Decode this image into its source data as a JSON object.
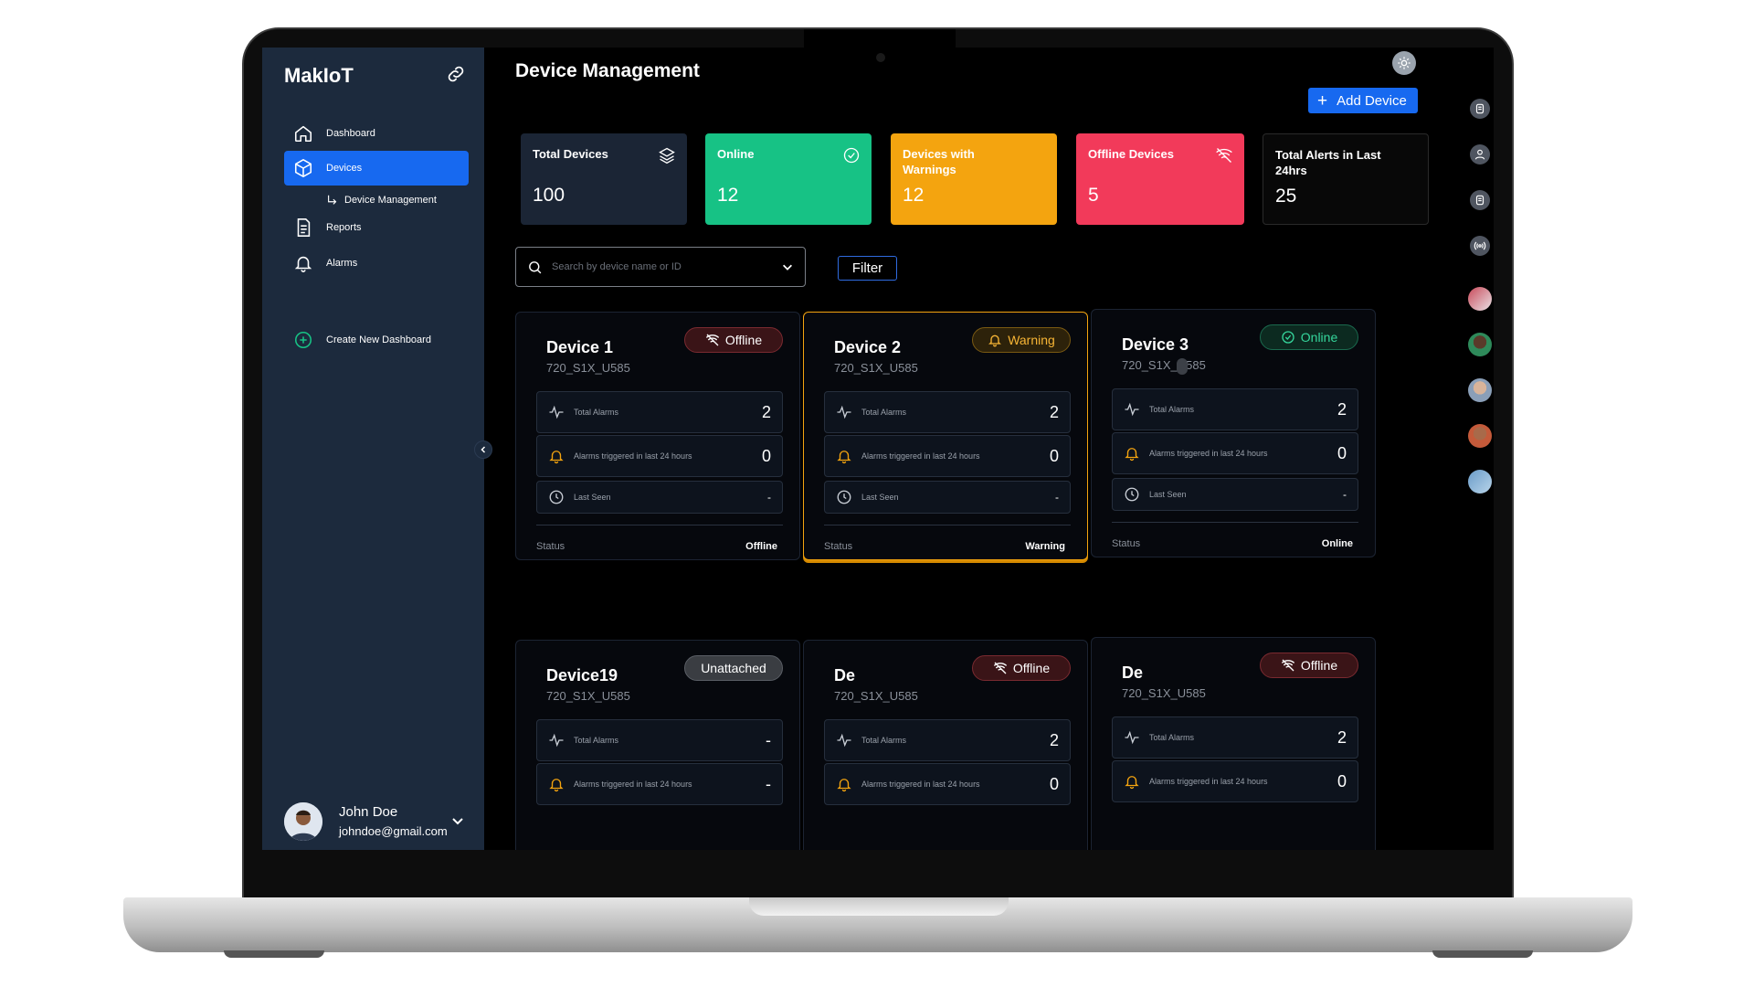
{
  "app": {
    "brand": "MakIoT"
  },
  "sidebar": {
    "items": [
      {
        "label": "Dashboard",
        "icon": "home-icon"
      },
      {
        "label": "Devices",
        "icon": "cube-icon"
      },
      {
        "label": "Reports",
        "icon": "document-icon"
      },
      {
        "label": "Alarms",
        "icon": "bell-icon"
      }
    ],
    "sub_item": "Device Management",
    "create_dashboard": "Create New Dashboard",
    "user": {
      "name": "John Doe",
      "email": "johndoe@gmail.com"
    }
  },
  "header": {
    "title": "Device Management",
    "add_device_label": "Add Device"
  },
  "stats": {
    "total": {
      "label": "Total Devices",
      "value": "100"
    },
    "online": {
      "label": "Online",
      "value": "12"
    },
    "warnings": {
      "label": "Devices with Warnings",
      "value": "12"
    },
    "offline": {
      "label": "Offline Devices",
      "value": "5"
    },
    "alerts": {
      "label": "Total Alerts in Last 24hrs",
      "value": "25"
    }
  },
  "search": {
    "placeholder": "Search by device name or ID",
    "filter_label": "Filter"
  },
  "row_labels": {
    "total_alarms": "Total Alarms",
    "alarms_24h": "Alarms triggered in last 24 hours",
    "last_seen": "Last Seen",
    "status": "Status"
  },
  "devices": [
    {
      "name": "Device 1",
      "id": "720_S1X_U585",
      "badge": "Offline",
      "total_alarms": "2",
      "alarms_24h": "0",
      "last_seen": "-",
      "status": "Offline"
    },
    {
      "name": "Device 2",
      "id": "720_S1X_U585",
      "badge": "Warning",
      "total_alarms": "2",
      "alarms_24h": "0",
      "last_seen": "-",
      "status": "Warning"
    },
    {
      "name": "Device 3",
      "id": "720_S1X_U585",
      "badge": "Online",
      "total_alarms": "2",
      "alarms_24h": "0",
      "last_seen": "-",
      "status": "Online"
    },
    {
      "name": "Device19",
      "id": "720_S1X_U585",
      "badge": "Unattached",
      "total_alarms": "-",
      "alarms_24h": "-"
    },
    {
      "name": "De",
      "id": "720_S1X_U585",
      "badge": "Offline",
      "total_alarms": "2",
      "alarms_24h": "0"
    },
    {
      "name": "De",
      "id": "720_S1X_U585",
      "badge": "Offline",
      "total_alarms": "2",
      "alarms_24h": "0"
    }
  ],
  "colors": {
    "accent": "#1769f0",
    "online": "#17c285",
    "warning": "#f4a40f",
    "offline": "#f23a5a",
    "sidebar": "#1c2a3d"
  }
}
